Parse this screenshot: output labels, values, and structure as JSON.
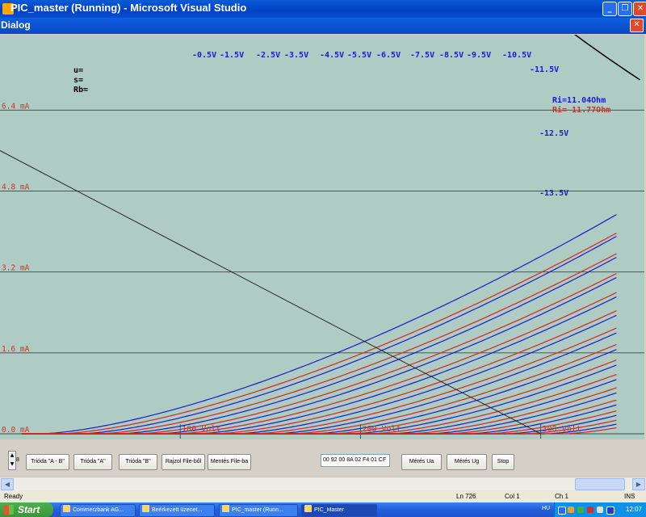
{
  "window": {
    "title": "PIC_master (Running) - Microsoft Visual Studio"
  },
  "dialog": {
    "title": "Dialog"
  },
  "plot": {
    "info": [
      "u=",
      "s=",
      "Rb="
    ],
    "y_labels": [
      "6.4 mA",
      "4.8 mA",
      "3.2 mA",
      "1.6 mA",
      "0.0 mA"
    ],
    "x_labels": [
      "100 Volt",
      "200 Volt",
      "300 Volt"
    ],
    "grid_labels": [
      "-0.5V",
      "-1.5V",
      "-2.5V",
      "-3.5V",
      "-4.5V",
      "-5.5V",
      "-6.5V",
      "-7.5V",
      "-8.5V",
      "-9.5V",
      "-10.5V",
      "-11.5V",
      "-12.5V",
      "-13.5V"
    ],
    "ri_blue": "Ri=11.04Ohm",
    "ri_red": "Ri= 11.77Ohm",
    "colors": {
      "background": "#aecbc4",
      "blue": "#1c1ccd",
      "red": "#d02a1e",
      "grid": "#3a4a46",
      "label_red": "#c43a2a"
    }
  },
  "chart_data": {
    "type": "line",
    "title": "",
    "xlabel": "",
    "ylabel": "",
    "xlim": [
      0,
      350
    ],
    "ylim": [
      0,
      8.5
    ],
    "x_ticks": [
      100,
      200,
      300
    ],
    "y_ticks": [
      0,
      1.6,
      3.2,
      4.8,
      6.4
    ],
    "grid": true,
    "series_blue_grid_voltages": [
      -0.5,
      -1.5,
      -2.5,
      -3.5,
      -4.5,
      -5.5,
      -6.5,
      -7.5,
      -8.5,
      -9.5,
      -10.5,
      -11.5,
      -12.5,
      -13.5
    ],
    "series_red_grid_voltages": [
      -0.5,
      -1.5,
      -2.5,
      -3.5,
      -4.5,
      -5.5,
      -6.5,
      -7.5,
      -8.5,
      -9.5,
      -10.5,
      -11.5,
      -12.5,
      -13.5
    ],
    "load_line": [
      [
        0,
        5.6
      ],
      [
        300,
        0
      ]
    ],
    "dissipation_curve": [
      [
        315,
        8.0
      ],
      [
        355,
        7.0
      ]
    ]
  },
  "controls": {
    "spin_value": "8",
    "buttons": [
      "Trióda \"A - B\"",
      "Trióda  \"A\"",
      "Trióda  \"B\"",
      "Rajzol File-ből",
      "Mentés File-ba"
    ],
    "data_value": "00 92 00 8A 02 F4 01 CF",
    "measure_buttons": [
      "Mérés Ua",
      "Mérés Ug",
      "Stop"
    ]
  },
  "status": {
    "ready": "Ready",
    "ln": "Ln 726",
    "col": "Col 1",
    "ch": "Ch 1",
    "ins": "INS"
  },
  "taskbar": {
    "start": "Start",
    "tasks": [
      "Commerzbank AG...",
      "Beérkezett üzenet...",
      "PIC_master (Runn...",
      "PIC_Master"
    ],
    "lang": "HU",
    "clock": "12:07"
  }
}
